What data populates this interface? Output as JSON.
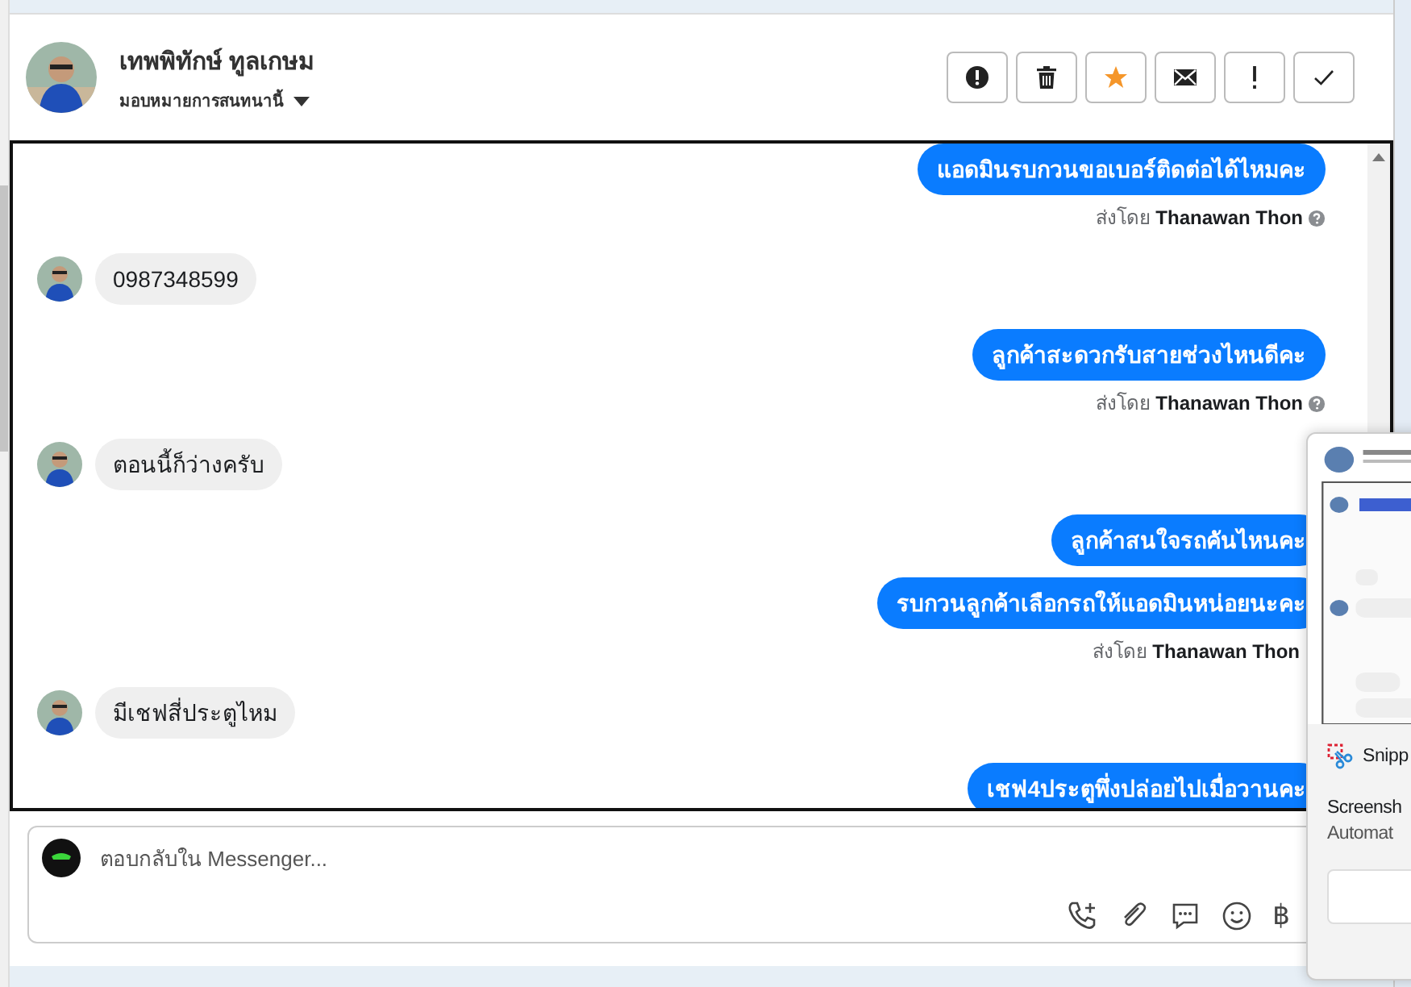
{
  "header": {
    "name": "เทพพิทักษ์ ทูลเกษม",
    "assign_label": "มอบหมายการสนทนานี้",
    "actions": [
      {
        "kind": "spam",
        "on": false
      },
      {
        "kind": "delete",
        "on": false
      },
      {
        "kind": "star",
        "on": true
      },
      {
        "kind": "mail",
        "on": false
      },
      {
        "kind": "important",
        "on": false
      },
      {
        "kind": "done",
        "on": false
      }
    ]
  },
  "messages": [
    {
      "kind": "out",
      "text": "แอดมินรบกวนขอเบอร์ติดต่อได้ไหมคะ"
    },
    {
      "kind": "meta",
      "prefix": "ส่งโดย",
      "sender": "Thanawan Thon",
      "info_icon": true
    },
    {
      "kind": "in",
      "text": "0987348599"
    },
    {
      "kind": "out",
      "text": "ลูกค้าสะดวกรับสายช่วงไหนดีคะ"
    },
    {
      "kind": "meta",
      "prefix": "ส่งโดย",
      "sender": "Thanawan Thon",
      "info_icon": true
    },
    {
      "kind": "in",
      "text": "ตอนนี้ก็ว่างครับ"
    },
    {
      "kind": "out",
      "text": "ลูกค้าสนใจรถคันไหนคะ"
    },
    {
      "kind": "out",
      "text": "รบกวนลูกค้าเลือกรถให้แอดมินหน่อยนะคะ"
    },
    {
      "kind": "meta",
      "prefix": "ส่งโดย",
      "sender": "Thanawan Thon",
      "info_icon": false
    },
    {
      "kind": "in",
      "text": "มีเชฟสี่ประตูไหม"
    },
    {
      "kind": "out",
      "text": "เชฟ4ประตูพึ่งปล่อยไปเมื่อวานคะ"
    }
  ],
  "composer": {
    "placeholder": "ตอบกลับใน Messenger...",
    "currency_glyph": "฿"
  },
  "snip_popup": {
    "app": "Snipp",
    "title": "Screensh",
    "subtitle": "Automat"
  }
}
